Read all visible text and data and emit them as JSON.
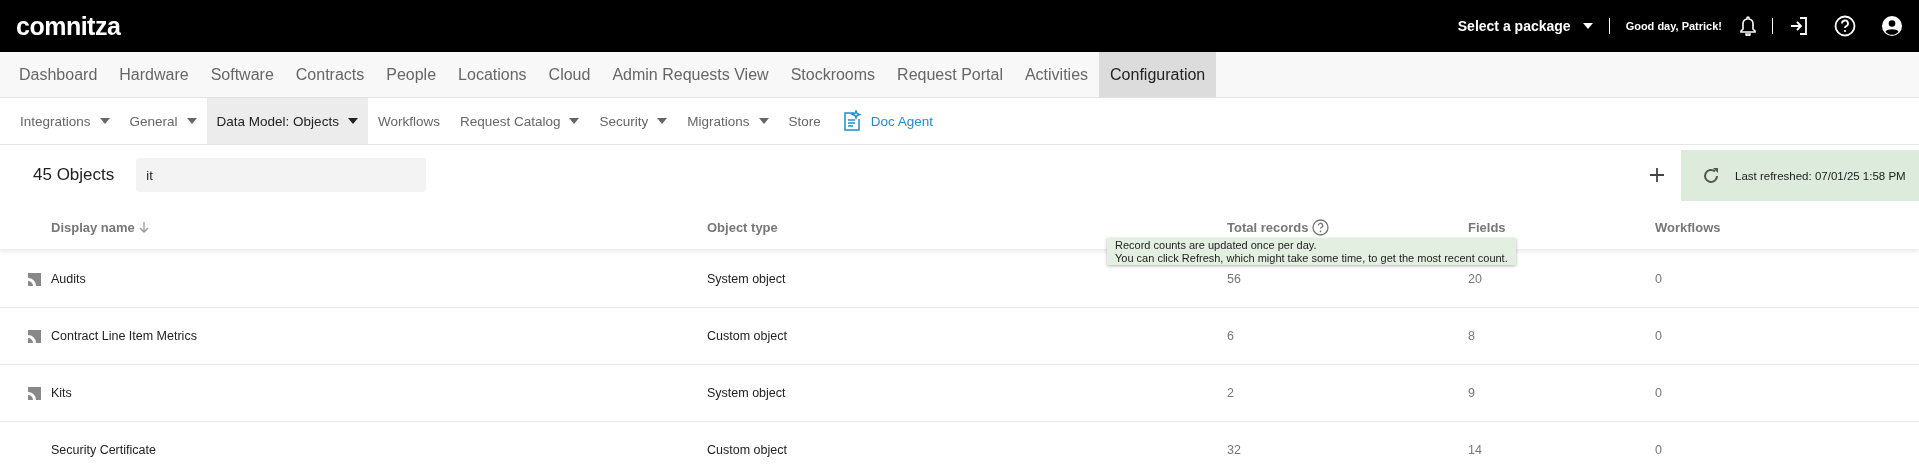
{
  "header": {
    "logo": "comnitza",
    "package_select": "Select a package",
    "greeting": "Good day, Patrick!"
  },
  "main_nav": [
    {
      "label": "Dashboard",
      "selected": false
    },
    {
      "label": "Hardware",
      "selected": false
    },
    {
      "label": "Software",
      "selected": false
    },
    {
      "label": "Contracts",
      "selected": false
    },
    {
      "label": "People",
      "selected": false
    },
    {
      "label": "Locations",
      "selected": false
    },
    {
      "label": "Cloud",
      "selected": false
    },
    {
      "label": "Admin Requests View",
      "selected": false
    },
    {
      "label": "Stockrooms",
      "selected": false
    },
    {
      "label": "Request Portal",
      "selected": false
    },
    {
      "label": "Activities",
      "selected": false
    },
    {
      "label": "Configuration",
      "selected": true
    }
  ],
  "sub_nav": [
    {
      "label": "Integrations",
      "kind": "menu",
      "selected": false
    },
    {
      "label": "General",
      "kind": "menu",
      "selected": false
    },
    {
      "label": "Data Model: Objects",
      "kind": "menu",
      "selected": true
    },
    {
      "label": "Workflows",
      "kind": "link",
      "selected": false
    },
    {
      "label": "Request Catalog",
      "kind": "menu",
      "selected": false
    },
    {
      "label": "Security",
      "kind": "menu",
      "selected": false
    },
    {
      "label": "Migrations",
      "kind": "menu",
      "selected": false
    },
    {
      "label": "Store",
      "kind": "link",
      "selected": false
    },
    {
      "label": "Doc Agent",
      "kind": "agent",
      "selected": false
    }
  ],
  "toolbar": {
    "count": "45 Objects",
    "search": {
      "value": "it"
    },
    "last_refreshed": "Last refreshed: 07/01/25 1:58 PM"
  },
  "table": {
    "columns": [
      {
        "label": "Display name",
        "kind": "sorted"
      },
      {
        "label": "Object type",
        "kind": "plain"
      },
      {
        "label": "Total records",
        "kind": "help"
      },
      {
        "label": "Fields",
        "kind": "plain"
      },
      {
        "label": "Workflows",
        "kind": "plain"
      }
    ],
    "tooltip": [
      "Record counts are updated once per day.",
      "You can click Refresh, which might take some time, to get the most recent count."
    ],
    "rows": [
      {
        "icon": true,
        "cells": [
          "Audits",
          "System object",
          "56",
          "20",
          "0"
        ]
      },
      {
        "icon": true,
        "cells": [
          "Contract Line Item Metrics",
          "Custom object",
          "6",
          "8",
          "0"
        ]
      },
      {
        "icon": true,
        "cells": [
          "Kits",
          "System object",
          "2",
          "9",
          "0"
        ]
      },
      {
        "icon": false,
        "cells": [
          "Security Certificate",
          "Custom object",
          "32",
          "14",
          "0"
        ]
      }
    ]
  }
}
